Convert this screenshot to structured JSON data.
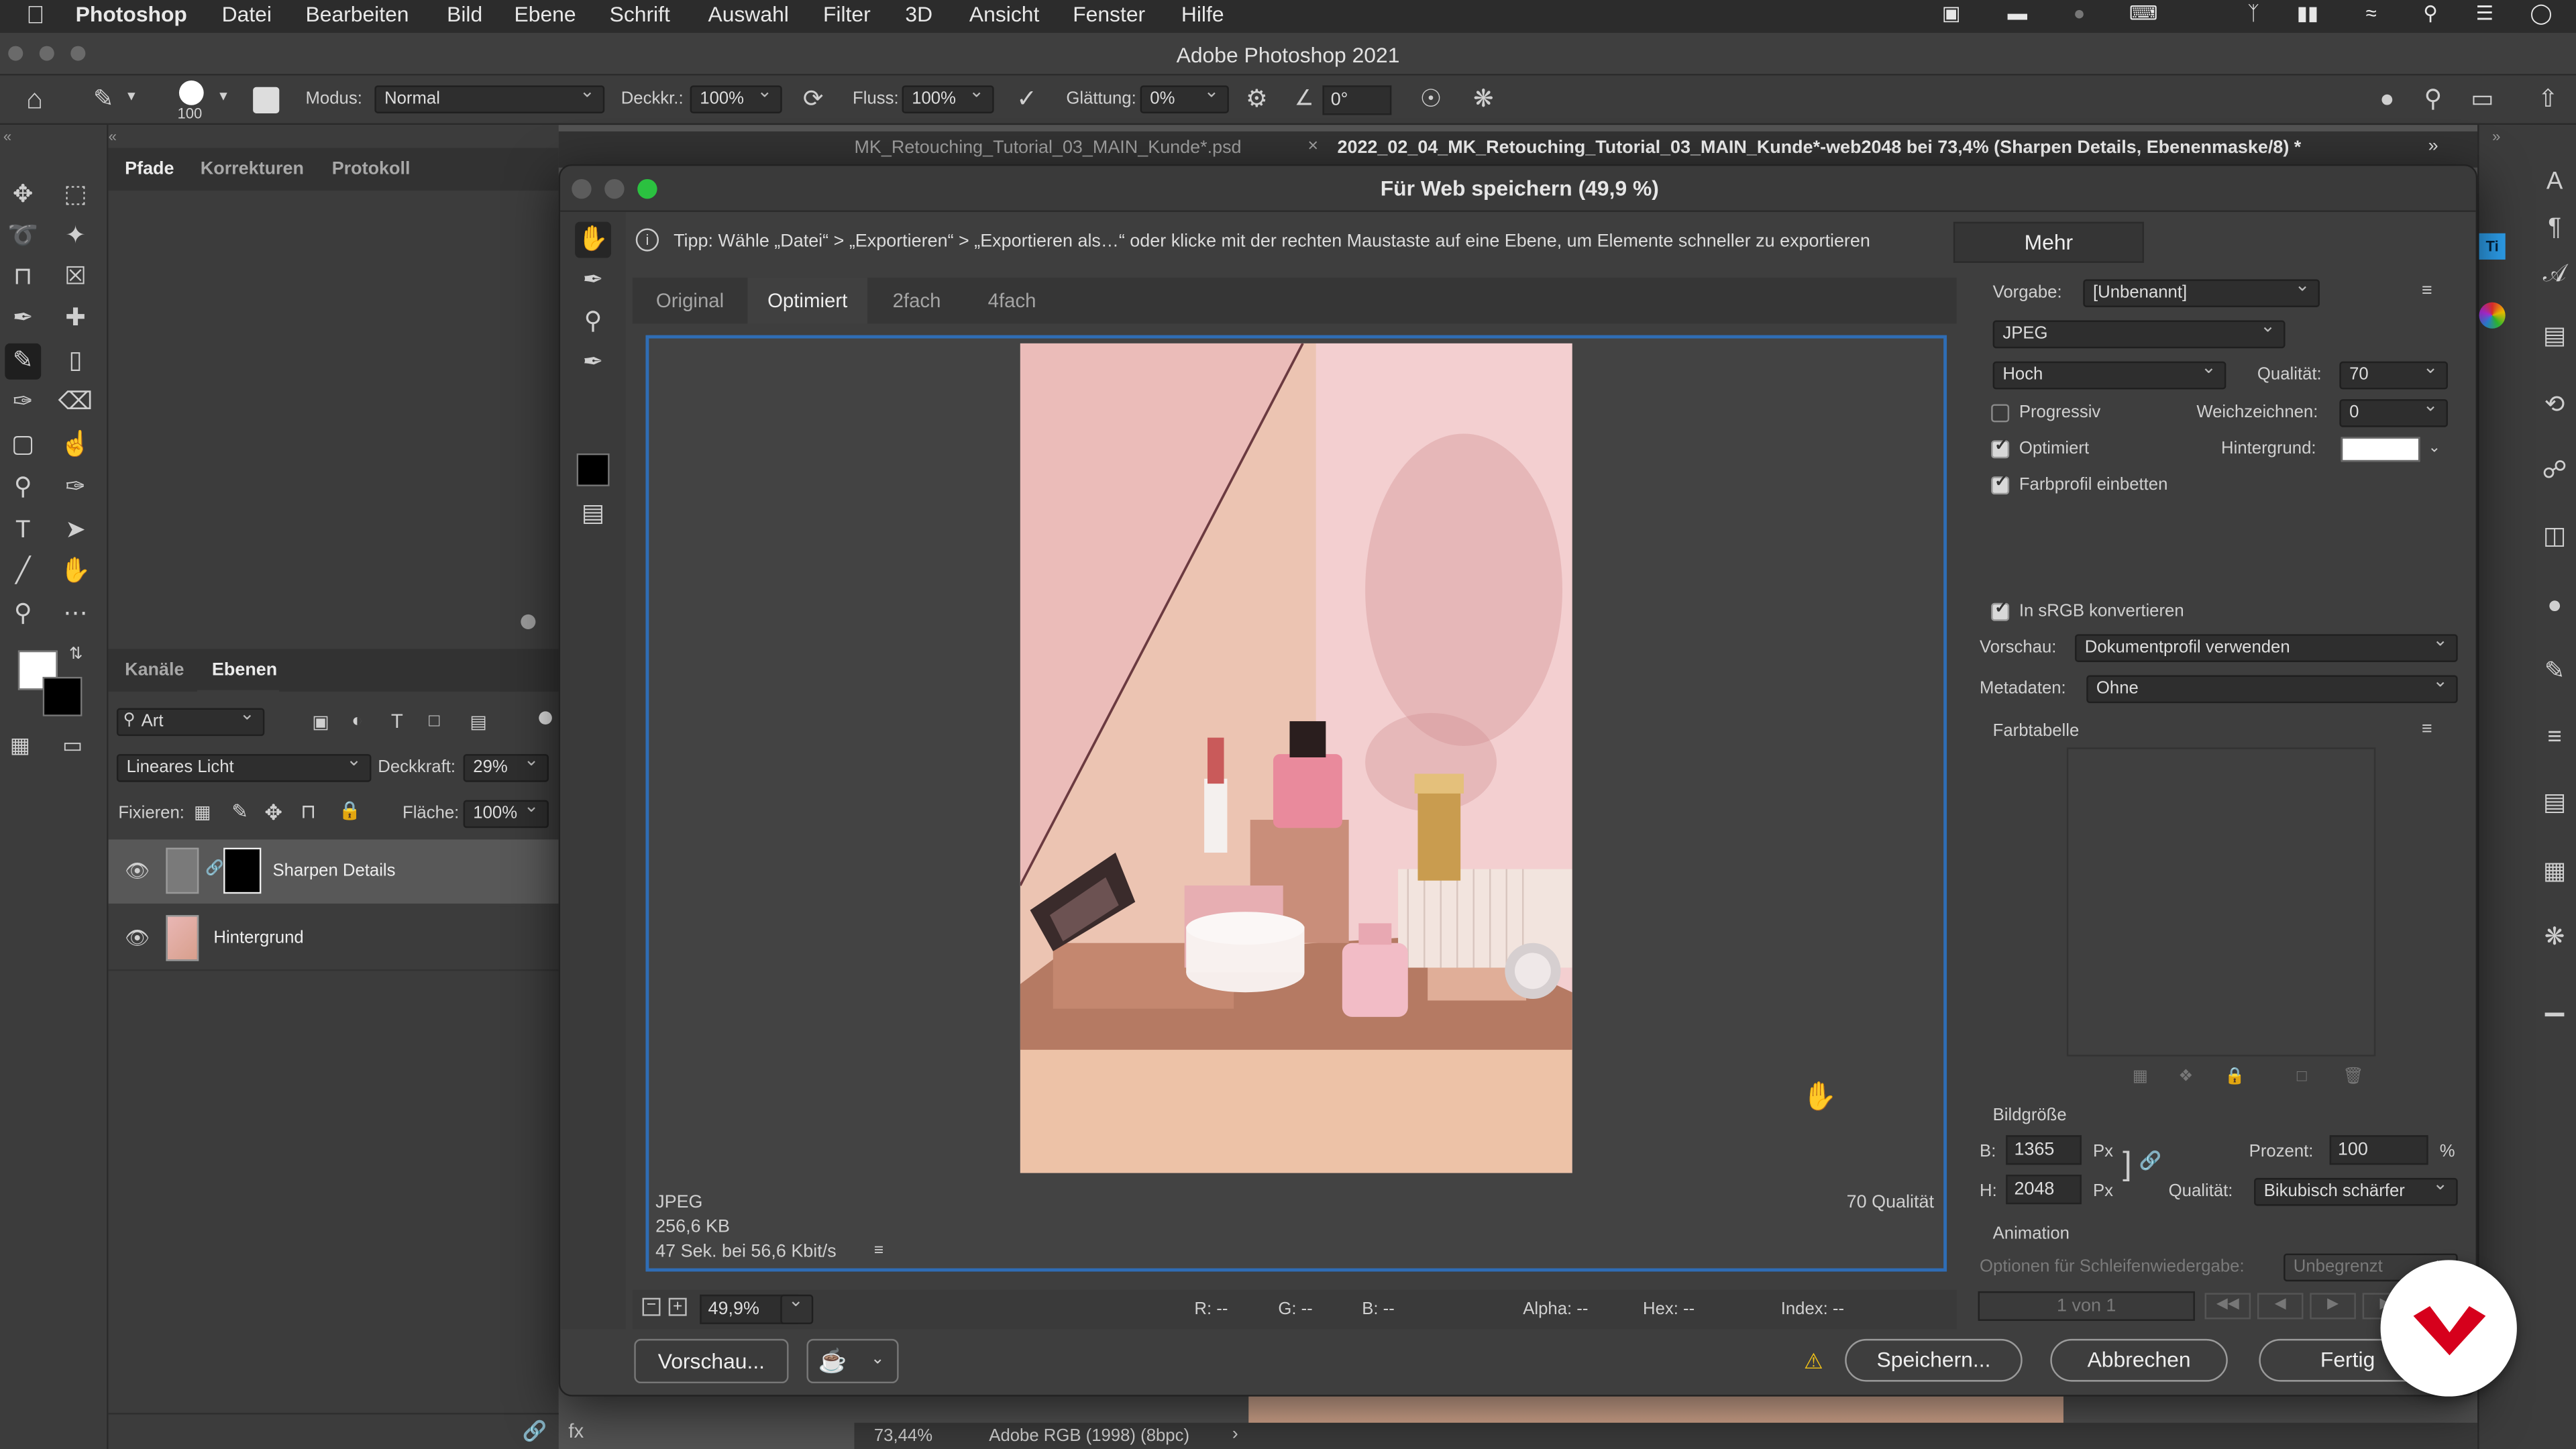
{
  "menubar": {
    "app": "Photoshop",
    "items": [
      "Datei",
      "Bearbeiten",
      "Bild",
      "Ebene",
      "Schrift",
      "Auswahl",
      "Filter",
      "3D",
      "Ansicht",
      "Fenster",
      "Hilfe"
    ]
  },
  "window_title": "Adobe Photoshop 2021",
  "options": {
    "brush_size": "100",
    "mode_label": "Modus:",
    "mode_value": "Normal",
    "opacity_label": "Deckkr.:",
    "opacity_value": "100%",
    "flow_label": "Fluss:",
    "flow_value": "100%",
    "smoothing_label": "Glättung:",
    "smoothing_value": "0%",
    "angle_value": "0°"
  },
  "doc_tabs": {
    "tab1": "MK_Retouching_Tutorial_03_MAIN_Kunde*.psd",
    "tab2": "2022_02_04_MK_Retouching_Tutorial_03_MAIN_Kunde*-web2048 bei 73,4% (Sharpen Details, Ebenenmaske/8) *"
  },
  "panels_top": {
    "tabs": [
      "Pfade",
      "Korrekturen",
      "Protokoll"
    ]
  },
  "layers_panel": {
    "tabs": [
      "Kanäle",
      "Ebenen"
    ],
    "filter": "Art",
    "blend_mode": "Lineares Licht",
    "opacity_label": "Deckkraft:",
    "opacity_value": "29%",
    "lock_label": "Fixieren:",
    "fill_label": "Fläche:",
    "fill_value": "100%",
    "layers": [
      {
        "name": "Sharpen Details"
      },
      {
        "name": "Hintergrund"
      }
    ]
  },
  "status_bar": {
    "zoom": "73,44%",
    "profile": "Adobe RGB (1998) (8bpc)"
  },
  "dialog": {
    "title": "Für Web speichern (49,9 %)",
    "tip": "Tipp: Wähle „Datei“ > „Exportieren“ > „Exportieren als…“ oder klicke mit der rechten Maustaste auf eine Ebene, um Elemente schneller zu exportieren",
    "more_button": "Mehr",
    "view_tabs": [
      "Original",
      "Optimiert",
      "2fach",
      "4fach"
    ],
    "active_tab": "Optimiert",
    "info_format": "JPEG",
    "info_size": "256,6 KB",
    "info_time": "47 Sek. bei 56,6 Kbit/s",
    "info_quality": "70 Qualität",
    "zoom": "49,9%",
    "readout": {
      "r": "R: --",
      "g": "G: --",
      "b": "B: --",
      "alpha": "Alpha: --",
      "hex": "Hex: --",
      "index": "Index: --"
    },
    "preview_button": "Vorschau...",
    "save_button": "Speichern...",
    "cancel_button": "Abbrechen",
    "done_button": "Fertig",
    "settings": {
      "preset_label": "Vorgabe:",
      "preset_value": "[Unbenannt]",
      "format": "JPEG",
      "quality_level": "Hoch",
      "quality_label": "Qualität:",
      "quality_value": "70",
      "progressive": "Progressiv",
      "blur_label": "Weichzeichnen:",
      "blur_value": "0",
      "optimized": "Optimiert",
      "matte_label": "Hintergrund:",
      "embed_profile": "Farbprofil einbetten",
      "convert_srgb": "In sRGB konvertieren",
      "preview_label": "Vorschau:",
      "preview_value": "Dokumentprofil verwenden",
      "metadata_label": "Metadaten:",
      "metadata_value": "Ohne",
      "color_table": "Farbtabelle",
      "image_size": "Bildgröße",
      "w_label": "B:",
      "w_value": "1365",
      "h_label": "H:",
      "h_value": "2048",
      "px": "Px",
      "percent_label": "Prozent:",
      "percent_value": "100",
      "percent_sign": "%",
      "resample_label": "Qualität:",
      "resample_value": "Bikubisch schärfer",
      "animation": "Animation",
      "loop_label": "Optionen für Schleifenwiedergabe:",
      "loop_value": "Unbegrenzt",
      "frame_counter": "1 von 1"
    }
  },
  "colors": {
    "accent": "#2f6db5",
    "brand_badge": "#d6001c"
  }
}
